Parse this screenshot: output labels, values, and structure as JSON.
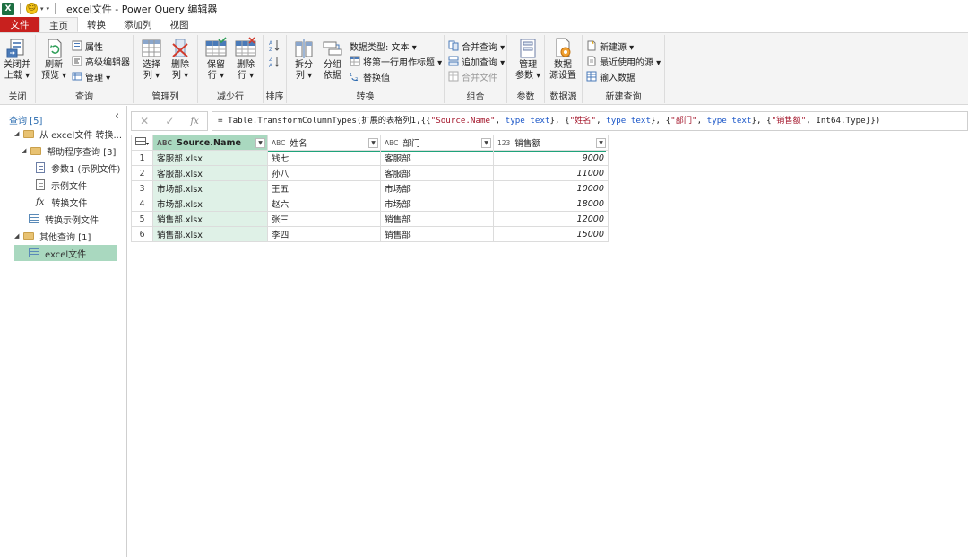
{
  "titlebar": {
    "app_logo": "X",
    "title": "excel文件 - Power Query 编辑器",
    "icons": [
      "excel-logo-icon",
      "smiley-icon"
    ]
  },
  "tabs": [
    {
      "label": "文件",
      "kind": "file"
    },
    {
      "label": "主页",
      "kind": "active"
    },
    {
      "label": "转换",
      "kind": "normal"
    },
    {
      "label": "添加列",
      "kind": "normal"
    },
    {
      "label": "视图",
      "kind": "normal"
    }
  ],
  "ribbon": {
    "close": {
      "label1": "关闭并",
      "label2": "上载 ▾",
      "group": "关闭"
    },
    "query": {
      "refresh1": "刷新",
      "refresh2": "预览 ▾",
      "properties": "属性",
      "advanced": "高级编辑器",
      "manage": "管理 ▾",
      "group": "查询"
    },
    "columns": {
      "choose1": "选择",
      "choose2": "列 ▾",
      "remove1": "删除",
      "remove2": "列 ▾",
      "group": "管理列"
    },
    "rows": {
      "keep1": "保留",
      "keep2": "行 ▾",
      "remove1": "删除",
      "remove2": "行 ▾",
      "group": "减少行"
    },
    "sort": {
      "group": "排序"
    },
    "transform": {
      "split1": "拆分",
      "split2": "列 ▾",
      "groupby1": "分组",
      "groupby2": "依据",
      "datatype": "数据类型: 文本 ▾",
      "firstrow": "将第一行用作标题 ▾",
      "replace": "替换值",
      "group": "转换"
    },
    "combine": {
      "merge": "合并查询 ▾",
      "append": "追加查询 ▾",
      "combine_files": "合并文件",
      "group": "组合"
    },
    "params": {
      "manage1": "管理",
      "manage2": "参数 ▾",
      "group": "参数"
    },
    "datasource": {
      "label1": "数据",
      "label2": "源设置",
      "group": "数据源"
    },
    "newquery": {
      "new": "新建源 ▾",
      "recent": "最近使用的源 ▾",
      "enter": "输入数据",
      "group": "新建查询"
    }
  },
  "queries_pane": {
    "header": "查询 [5]",
    "items": [
      {
        "label": "从 excel文件 转换...",
        "kind": "folder"
      },
      {
        "label": "帮助程序查询 [3]",
        "kind": "folder"
      },
      {
        "label": "参数1 (示例文件)",
        "kind": "param"
      },
      {
        "label": "示例文件",
        "kind": "doc"
      },
      {
        "label": "转换文件",
        "kind": "fx"
      },
      {
        "label": "转换示例文件",
        "kind": "table"
      },
      {
        "label": "其他查询 [1]",
        "kind": "folder"
      },
      {
        "label": "excel文件",
        "kind": "table-selected"
      }
    ]
  },
  "formula": {
    "prefix": "= Table.TransformColumnTypes(扩展的表格列1,{{",
    "parts": [
      {
        "t": "\"Source.Name\"",
        "c": "str"
      },
      {
        "t": ", ",
        "c": ""
      },
      {
        "t": "type",
        "c": "kw"
      },
      {
        "t": " ",
        "c": ""
      },
      {
        "t": "text",
        "c": "kw"
      },
      {
        "t": "}, {",
        "c": ""
      },
      {
        "t": "\"姓名\"",
        "c": "str"
      },
      {
        "t": ", ",
        "c": ""
      },
      {
        "t": "type",
        "c": "kw"
      },
      {
        "t": " ",
        "c": ""
      },
      {
        "t": "text",
        "c": "kw"
      },
      {
        "t": "}, {",
        "c": ""
      },
      {
        "t": "\"部门\"",
        "c": "str"
      },
      {
        "t": ", ",
        "c": ""
      },
      {
        "t": "type",
        "c": "kw"
      },
      {
        "t": " ",
        "c": ""
      },
      {
        "t": "text",
        "c": "kw"
      },
      {
        "t": "}, {",
        "c": ""
      },
      {
        "t": "\"销售额\"",
        "c": "str"
      },
      {
        "t": ", Int64.Type}})",
        "c": ""
      }
    ]
  },
  "grid": {
    "columns": [
      {
        "name": "Source.Name",
        "type": "ABC",
        "selected": true
      },
      {
        "name": "姓名",
        "type": "ABC",
        "selected": false
      },
      {
        "name": "部门",
        "type": "ABC",
        "selected": false
      },
      {
        "name": "销售额",
        "type": "123",
        "selected": false
      }
    ],
    "rows": [
      [
        "1",
        "客服部.xlsx",
        "钱七",
        "客服部",
        "9000"
      ],
      [
        "2",
        "客服部.xlsx",
        "孙八",
        "客服部",
        "11000"
      ],
      [
        "3",
        "市场部.xlsx",
        "王五",
        "市场部",
        "10000"
      ],
      [
        "4",
        "市场部.xlsx",
        "赵六",
        "市场部",
        "18000"
      ],
      [
        "5",
        "销售部.xlsx",
        "张三",
        "销售部",
        "12000"
      ],
      [
        "6",
        "销售部.xlsx",
        "李四",
        "销售部",
        "15000"
      ]
    ]
  },
  "colors": {
    "file_tab": "#c8201e",
    "selection": "#a9d8bf",
    "quality_bar": "#1fa37a"
  }
}
